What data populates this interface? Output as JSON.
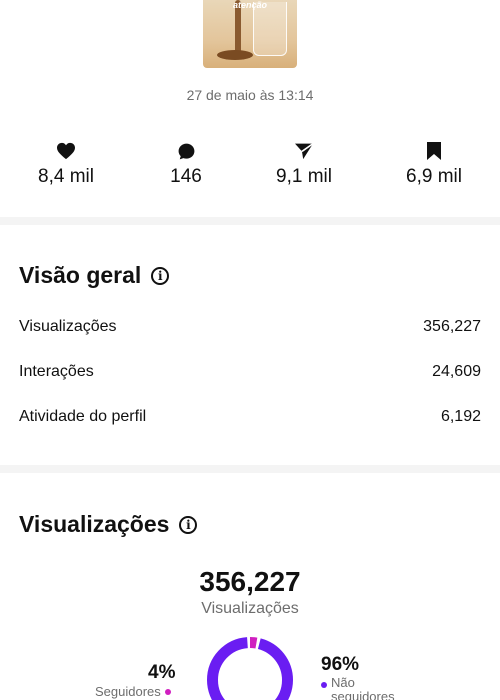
{
  "post": {
    "thumbnail_text": "atenção",
    "date": "27 de maio às 13:14"
  },
  "stats": [
    {
      "icon": "heart-icon",
      "value": "8,4 mil"
    },
    {
      "icon": "comment-icon",
      "value": "146"
    },
    {
      "icon": "share-icon",
      "value": "9,1 mil"
    },
    {
      "icon": "bookmark-icon",
      "value": "6,9 mil"
    }
  ],
  "overview": {
    "title": "Visão geral",
    "rows": [
      {
        "label": "Visualizações",
        "value": "356,227"
      },
      {
        "label": "Interações",
        "value": "24,609"
      },
      {
        "label": "Atividade do perfil",
        "value": "6,192"
      }
    ]
  },
  "views": {
    "title": "Visualizações",
    "total": "356,227",
    "total_label": "Visualizações",
    "followers": {
      "percent": "4%",
      "label": "Seguidores",
      "fraction": 0.04,
      "color": "#d01fc0"
    },
    "non_followers": {
      "percent": "96%",
      "label": "Não seguidores",
      "fraction": 0.96,
      "color": "#6a1df2"
    }
  }
}
